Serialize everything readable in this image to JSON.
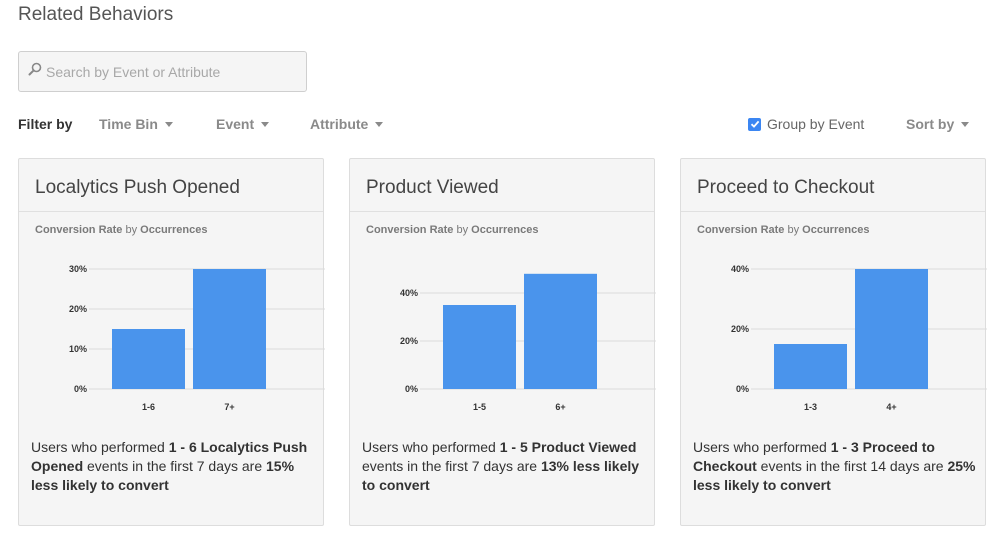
{
  "page": {
    "title": "Related Behaviors"
  },
  "search": {
    "placeholder": "Search by Event or Attribute",
    "value": ""
  },
  "filters": {
    "label": "Filter by",
    "time_bin": "Time Bin",
    "event": "Event",
    "attribute": "Attribute",
    "group_by_event": {
      "label": "Group by Event",
      "checked": true
    },
    "sort_by": "Sort by"
  },
  "colors": {
    "bar": "#4a94ec",
    "checkbox": "#3b86f2"
  },
  "icons": {
    "search": "search-icon",
    "caret": "caret-down-icon",
    "check": "check-icon"
  },
  "cards": [
    {
      "title": "Localytics Push Opened",
      "subtitle": {
        "metric": "Conversion Rate",
        "by": "by",
        "dimension": "Occurrences"
      },
      "summary": {
        "p1": "Users who performed ",
        "b1": "1 - 6 Localytics Push Opened",
        "p2": " events in the first 7 days are ",
        "b2": "15% less likely to convert"
      },
      "chart_data": {
        "type": "bar",
        "categories": [
          "1-6",
          "7+"
        ],
        "values": [
          15,
          30
        ],
        "yticks": [
          "0%",
          "10%",
          "20%",
          "30%"
        ],
        "ylim": [
          0,
          30
        ]
      }
    },
    {
      "title": "Product Viewed",
      "subtitle": {
        "metric": "Conversion Rate",
        "by": "by",
        "dimension": "Occurrences"
      },
      "summary": {
        "p1": "Users who performed ",
        "b1": "1 - 5 Product Viewed",
        "p2": " events in the first 7 days are ",
        "b2": "13% less likely to convert"
      },
      "chart_data": {
        "type": "bar",
        "categories": [
          "1-5",
          "6+"
        ],
        "values": [
          35,
          48
        ],
        "yticks": [
          "0%",
          "20%",
          "40%"
        ],
        "ylim": [
          0,
          50
        ]
      }
    },
    {
      "title": "Proceed to Checkout",
      "subtitle": {
        "metric": "Conversion Rate",
        "by": "by",
        "dimension": "Occurrences"
      },
      "summary": {
        "p1": "Users who performed ",
        "b1": "1 - 3 Proceed to Checkout",
        "p2": " events in the first 14 days are ",
        "b2": "25% less likely to convert"
      },
      "chart_data": {
        "type": "bar",
        "categories": [
          "1-3",
          "4+"
        ],
        "values": [
          15,
          40
        ],
        "yticks": [
          "0%",
          "20%",
          "40%"
        ],
        "ylim": [
          0,
          40
        ]
      }
    }
  ]
}
